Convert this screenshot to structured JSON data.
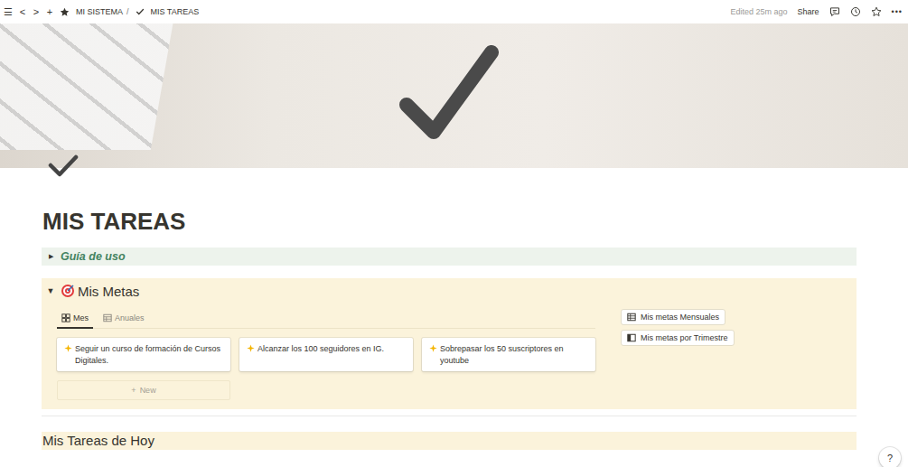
{
  "topbar": {
    "nav": [
      "☰",
      "<",
      ">",
      "+"
    ],
    "breadcrumb": [
      {
        "label": "MI SISTEMA",
        "separator": "/"
      },
      {
        "label": "MIS TAREAS",
        "separator": ""
      }
    ],
    "edited": "Edited 25m ago",
    "share": "Share",
    "more": "•••"
  },
  "page": {
    "title": "MIS TAREAS"
  },
  "guide_toggle": {
    "arrow": "▶",
    "label": "Guía de uso",
    "expanded": false
  },
  "goals_toggle": {
    "arrow": "▼",
    "label": "Mis Metas",
    "expanded": true,
    "tabs": [
      {
        "label": "Mes",
        "kind": "gallery",
        "selected": true
      },
      {
        "label": "Anuales",
        "kind": "table",
        "selected": false
      }
    ],
    "cards": [
      "Seguir un curso de formación de Cursos Digitales.",
      "Alcanzar los  100 seguidores en IG.",
      "Sobrepasar los 50 suscriptores en youtube"
    ],
    "new_button": {
      "icon": "+",
      "label": "New"
    },
    "links": [
      {
        "label": "Mis metas Mensuales",
        "kind": "table"
      },
      {
        "label": "Mis metas por Trimestre",
        "kind": "board"
      }
    ]
  },
  "section_heading": "Mis Tareas de Hoy",
  "help": "?"
}
